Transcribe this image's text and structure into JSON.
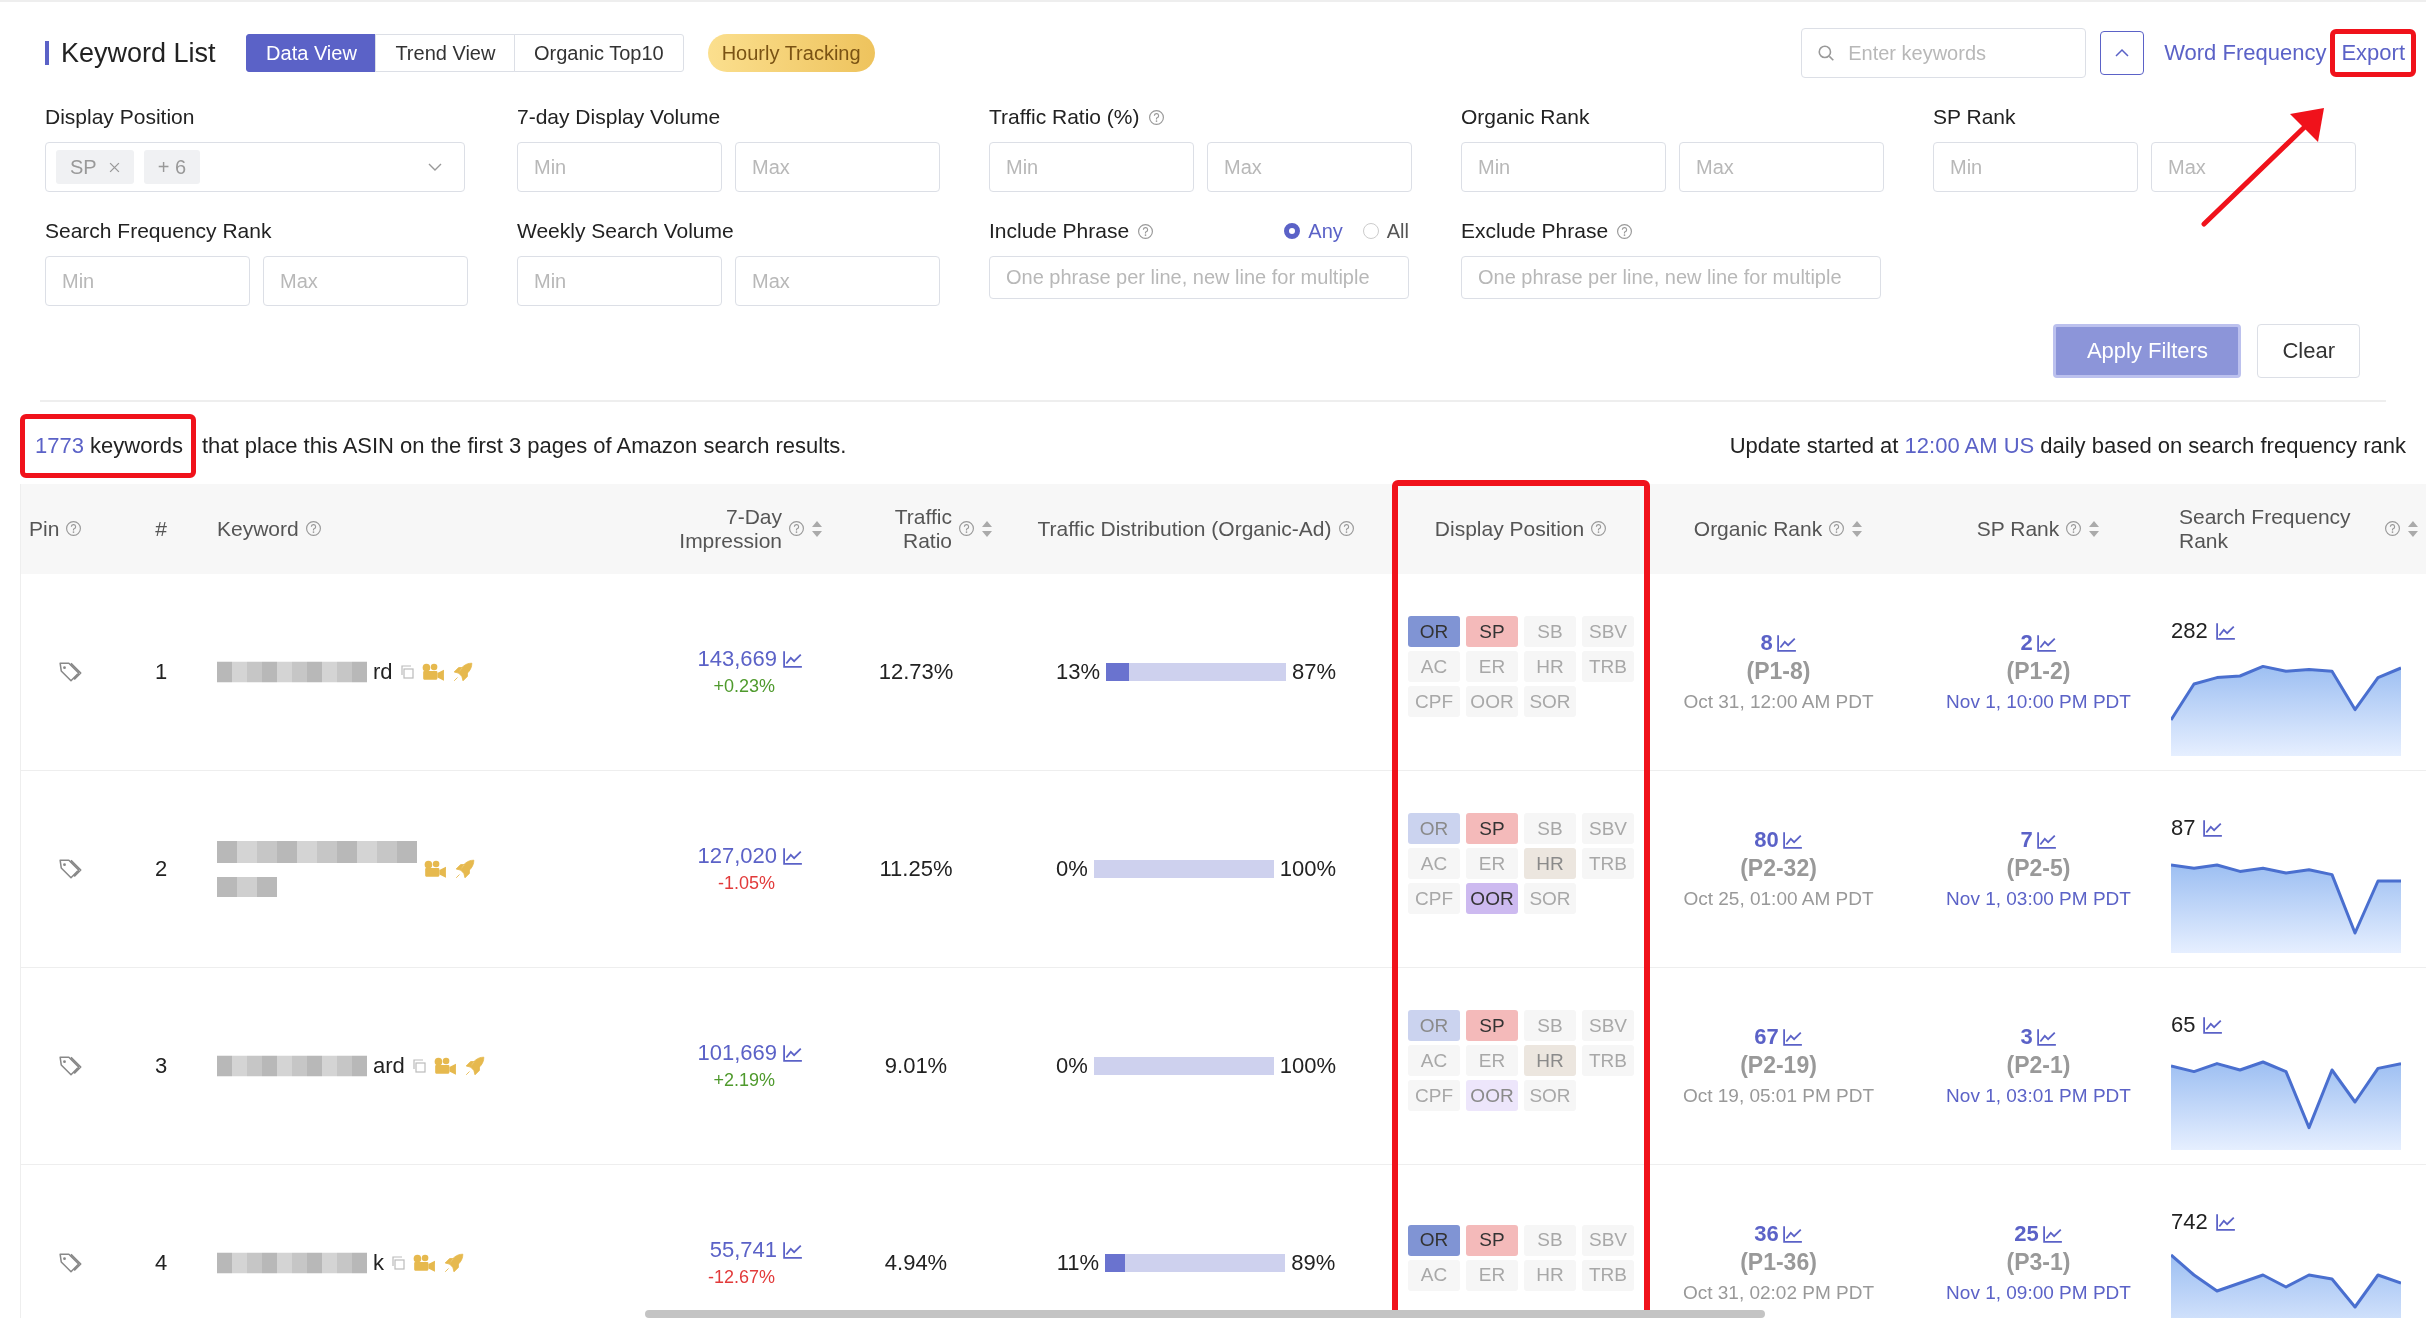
{
  "header": {
    "title": "Keyword List",
    "tabs": [
      {
        "label": "Data View",
        "selected": true
      },
      {
        "label": "Trend View",
        "selected": false
      },
      {
        "label": "Organic Top10",
        "selected": false
      }
    ],
    "badge": "Hourly Tracking",
    "search": {
      "placeholder": "Enter keywords"
    },
    "links": [
      "Word Frequency",
      "Export"
    ]
  },
  "filters": [
    {
      "label": "Display Position",
      "kind": "select",
      "help": false,
      "tags": [
        {
          "label": "SP",
          "removable": true
        },
        {
          "label": "+ 6",
          "removable": false
        }
      ]
    },
    {
      "label": "7-day Display Volume",
      "kind": "range",
      "help": false,
      "placeholder_min": "Min",
      "placeholder_max": "Max"
    },
    {
      "label": "Traffic Ratio (%)",
      "kind": "range",
      "help": true,
      "placeholder_min": "Min",
      "placeholder_max": "Max"
    },
    {
      "label": "Organic Rank",
      "kind": "range",
      "help": false,
      "placeholder_min": "Min",
      "placeholder_max": "Max"
    },
    {
      "label": "SP Rank",
      "kind": "range",
      "help": false,
      "placeholder_min": "Min",
      "placeholder_max": "Max"
    },
    {
      "label": "Search Frequency Rank",
      "kind": "range",
      "help": false,
      "placeholder_min": "Min",
      "placeholder_max": "Max"
    },
    {
      "label": "Weekly Search Volume",
      "kind": "range",
      "help": false,
      "placeholder_min": "Min",
      "placeholder_max": "Max"
    },
    {
      "label": "Include Phrase",
      "kind": "phrase",
      "help": true,
      "radios": [
        {
          "label": "Any",
          "selected": true
        },
        {
          "label": "All",
          "selected": false
        }
      ],
      "placeholder": "One phrase per line, new line for multiple"
    },
    {
      "label": "Exclude Phrase",
      "kind": "phrase",
      "help": true,
      "placeholder": "One phrase per line, new line for multiple"
    }
  ],
  "actions": [
    {
      "label": "Apply Filters",
      "kind": "primary"
    },
    {
      "label": "Clear",
      "kind": "default"
    }
  ],
  "summary": {
    "count": "1773",
    "unit": "keywords",
    "text": "that place this ASIN on the first 3 pages of Amazon search results."
  },
  "update": {
    "prefix": "Update started at",
    "time": "12:00 AM US",
    "suffix": "daily based on search frequency rank"
  },
  "columns": [
    {
      "label": "Pin",
      "help": true,
      "sortable": false
    },
    {
      "label": "#",
      "help": false,
      "sortable": false
    },
    {
      "label": "Keyword",
      "help": true,
      "sortable": false
    },
    {
      "label": "7-Day Impression",
      "help": true,
      "sortable": true
    },
    {
      "label": "Traffic Ratio",
      "help": true,
      "sortable": true
    },
    {
      "label": "Traffic Distribution (Organic-Ad)",
      "help": true,
      "sortable": false
    },
    {
      "label": "Display Position",
      "help": true,
      "sortable": false
    },
    {
      "label": "Organic Rank",
      "help": true,
      "sortable": true
    },
    {
      "label": "SP Rank",
      "help": true,
      "sortable": true
    },
    {
      "label": "Search Frequency Rank",
      "help": true,
      "sortable": true
    }
  ],
  "rows": [
    {
      "index": "1",
      "keyword_visible": "rd",
      "copyable": true,
      "impression": "143,669",
      "change": "+0.23%",
      "rising": true,
      "traffic_ratio": "12.73%",
      "organic_share": "13%",
      "ad_share": "87%",
      "level": 0.13,
      "positions": [
        {
          "label": "OR",
          "active": true,
          "faded": false,
          "color": "#8094d4"
        },
        {
          "label": "SP",
          "active": true,
          "faded": false,
          "color": "#f4baba"
        },
        {
          "label": "SB",
          "active": false
        },
        {
          "label": "SBV",
          "active": false
        },
        {
          "label": "AC",
          "active": false
        },
        {
          "label": "ER",
          "active": false
        },
        {
          "label": "HR",
          "active": false
        },
        {
          "label": "TRB",
          "active": false
        },
        {
          "label": "CPF",
          "active": false
        },
        {
          "label": "OOR",
          "active": false
        },
        {
          "label": "SOR",
          "active": false
        }
      ],
      "organic_rank": {
        "rank": "8",
        "page": "(P1-8)",
        "time": "Oct 31, 12:00 AM PDT"
      },
      "sp_rank": {
        "rank": "2",
        "page": "(P1-2)",
        "time": "Nov 1, 10:00 PM PDT"
      },
      "search_rank": "282"
    },
    {
      "index": "2",
      "copyable": false,
      "impression": "127,020",
      "change": "-1.05%",
      "rising": false,
      "traffic_ratio": "11.25%",
      "organic_share": "0%",
      "ad_share": "100%",
      "level": 0,
      "positions": [
        {
          "label": "OR",
          "active": true,
          "faded": true,
          "color": "#cbd3ef"
        },
        {
          "label": "SP",
          "active": true,
          "faded": false,
          "color": "#f4baba"
        },
        {
          "label": "SB",
          "active": false
        },
        {
          "label": "SBV",
          "active": false
        },
        {
          "label": "AC",
          "active": false
        },
        {
          "label": "ER",
          "active": false
        },
        {
          "label": "HR",
          "active": true,
          "faded": true,
          "color": "#ece6df"
        },
        {
          "label": "TRB",
          "active": false
        },
        {
          "label": "CPF",
          "active": false
        },
        {
          "label": "OOR",
          "active": true,
          "faded": false,
          "color": "#cdbaf0"
        },
        {
          "label": "SOR",
          "active": false
        }
      ],
      "organic_rank": {
        "rank": "80",
        "page": "(P2-32)",
        "time": "Oct 25, 01:00 AM PDT"
      },
      "sp_rank": {
        "rank": "7",
        "page": "(P2-5)",
        "time": "Nov 1, 03:00 PM PDT"
      },
      "search_rank": "87"
    },
    {
      "index": "3",
      "keyword_visible": "ard",
      "copyable": true,
      "impression": "101,669",
      "change": "+2.19%",
      "rising": true,
      "traffic_ratio": "9.01%",
      "organic_share": "0%",
      "ad_share": "100%",
      "level": 0,
      "positions": [
        {
          "label": "OR",
          "active": true,
          "faded": true,
          "color": "#cbd3ef"
        },
        {
          "label": "SP",
          "active": true,
          "faded": false,
          "color": "#f4baba"
        },
        {
          "label": "SB",
          "active": false
        },
        {
          "label": "SBV",
          "active": false
        },
        {
          "label": "AC",
          "active": false
        },
        {
          "label": "ER",
          "active": false
        },
        {
          "label": "HR",
          "active": true,
          "faded": true,
          "color": "#ece6df"
        },
        {
          "label": "TRB",
          "active": false
        },
        {
          "label": "CPF",
          "active": false
        },
        {
          "label": "OOR",
          "active": true,
          "faded": true,
          "color": "#ede6fb"
        },
        {
          "label": "SOR",
          "active": false
        }
      ],
      "organic_rank": {
        "rank": "67",
        "page": "(P2-19)",
        "time": "Oct 19, 05:01 PM PDT"
      },
      "sp_rank": {
        "rank": "3",
        "page": "(P2-1)",
        "time": "Nov 1, 03:01 PM PDT"
      },
      "search_rank": "65"
    },
    {
      "index": "4",
      "keyword_visible": "k",
      "copyable": true,
      "impression": "55,741",
      "change": "-12.67%",
      "rising": false,
      "traffic_ratio": "4.94%",
      "organic_share": "11%",
      "ad_share": "89%",
      "level": 0.11,
      "positions": [
        {
          "label": "OR",
          "active": true,
          "faded": false,
          "color": "#8094d4"
        },
        {
          "label": "SP",
          "active": true,
          "faded": false,
          "color": "#f4baba"
        },
        {
          "label": "SB",
          "active": false
        },
        {
          "label": "SBV",
          "active": false
        },
        {
          "label": "AC",
          "active": false
        },
        {
          "label": "ER",
          "active": false
        },
        {
          "label": "HR",
          "active": false
        },
        {
          "label": "TRB",
          "active": false
        }
      ],
      "organic_rank": {
        "rank": "36",
        "page": "(P1-36)",
        "time": "Oct 31, 02:02 PM PDT"
      },
      "sp_rank": {
        "rank": "25",
        "page": "(P3-1)",
        "time": "Nov 1, 09:00 PM PDT"
      },
      "search_rank": "742"
    }
  ]
}
